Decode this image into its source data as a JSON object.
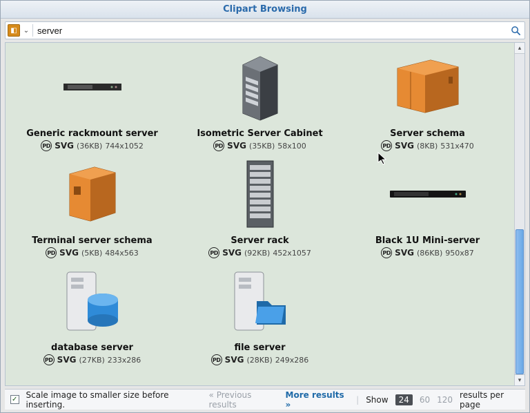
{
  "window": {
    "title": "Clipart Browsing"
  },
  "search": {
    "value": "server",
    "placeholder": ""
  },
  "items": [
    {
      "title": "Generic rackmount server",
      "format": "SVG",
      "size": "(36KB)",
      "dims": "744x1052"
    },
    {
      "title": "Isometric Server Cabinet",
      "format": "SVG",
      "size": "(35KB)",
      "dims": "58x100"
    },
    {
      "title": "Server schema",
      "format": "SVG",
      "size": "(8KB)",
      "dims": "531x470"
    },
    {
      "title": "Terminal server schema",
      "format": "SVG",
      "size": "(5KB)",
      "dims": "484x563"
    },
    {
      "title": "Server rack",
      "format": "SVG",
      "size": "(92KB)",
      "dims": "452x1057"
    },
    {
      "title": "Black 1U Mini-server",
      "format": "SVG",
      "size": "(86KB)",
      "dims": "950x87"
    },
    {
      "title": "database server",
      "format": "SVG",
      "size": "(27KB)",
      "dims": "233x286"
    },
    {
      "title": "file server",
      "format": "SVG",
      "size": "(28KB)",
      "dims": "249x286"
    }
  ],
  "license_label": "PD",
  "footer": {
    "scale_label": "Scale image to smaller size before inserting.",
    "scale_checked": true,
    "prev": "« Previous results",
    "more": "More results »",
    "show": "Show",
    "rpp": "results per page",
    "pages": [
      "24",
      "60",
      "120"
    ],
    "active_page": "24"
  },
  "icons": {
    "source": "◧",
    "chevron": "⌄",
    "search": "🔍",
    "up": "▴",
    "down": "▾",
    "check": "✓",
    "cursor": "➤"
  }
}
